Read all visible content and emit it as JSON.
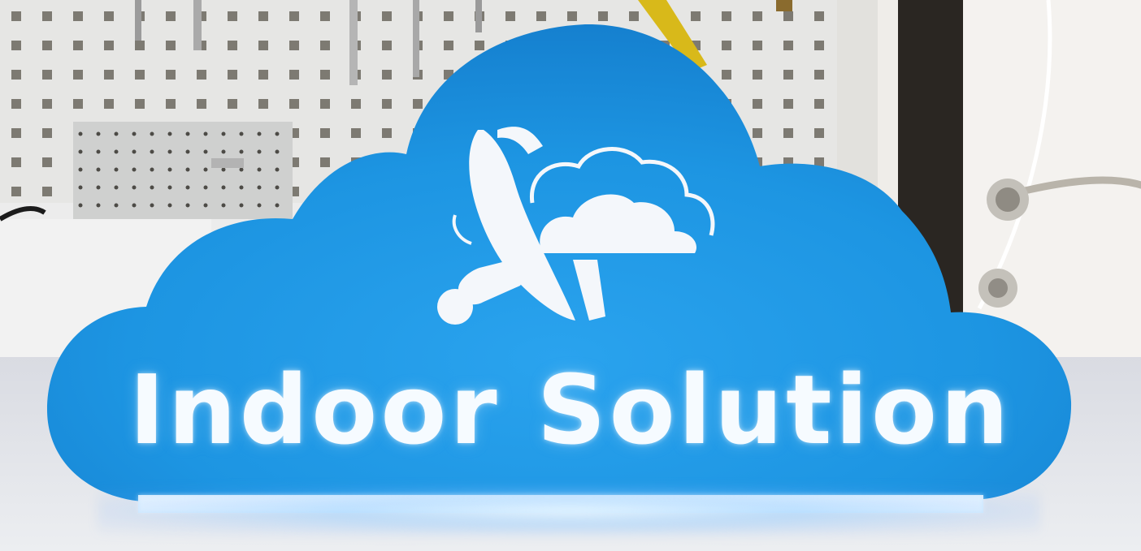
{
  "sign": {
    "text": "Indoor Solution"
  },
  "colors": {
    "sign_blue": "#1f97e3",
    "sign_blue_dark": "#1580cf",
    "logo_white": "#f4f7fb",
    "led_glow": "#bfe3ff",
    "pegboard": "#e6e6e4",
    "pegboard_hole": "#7d7a72",
    "door_frame": "#2a2622",
    "wall": "#efede9",
    "table": "#e7e7ea"
  },
  "icons": {
    "logo": "satellite-dish-cloud-icon"
  }
}
